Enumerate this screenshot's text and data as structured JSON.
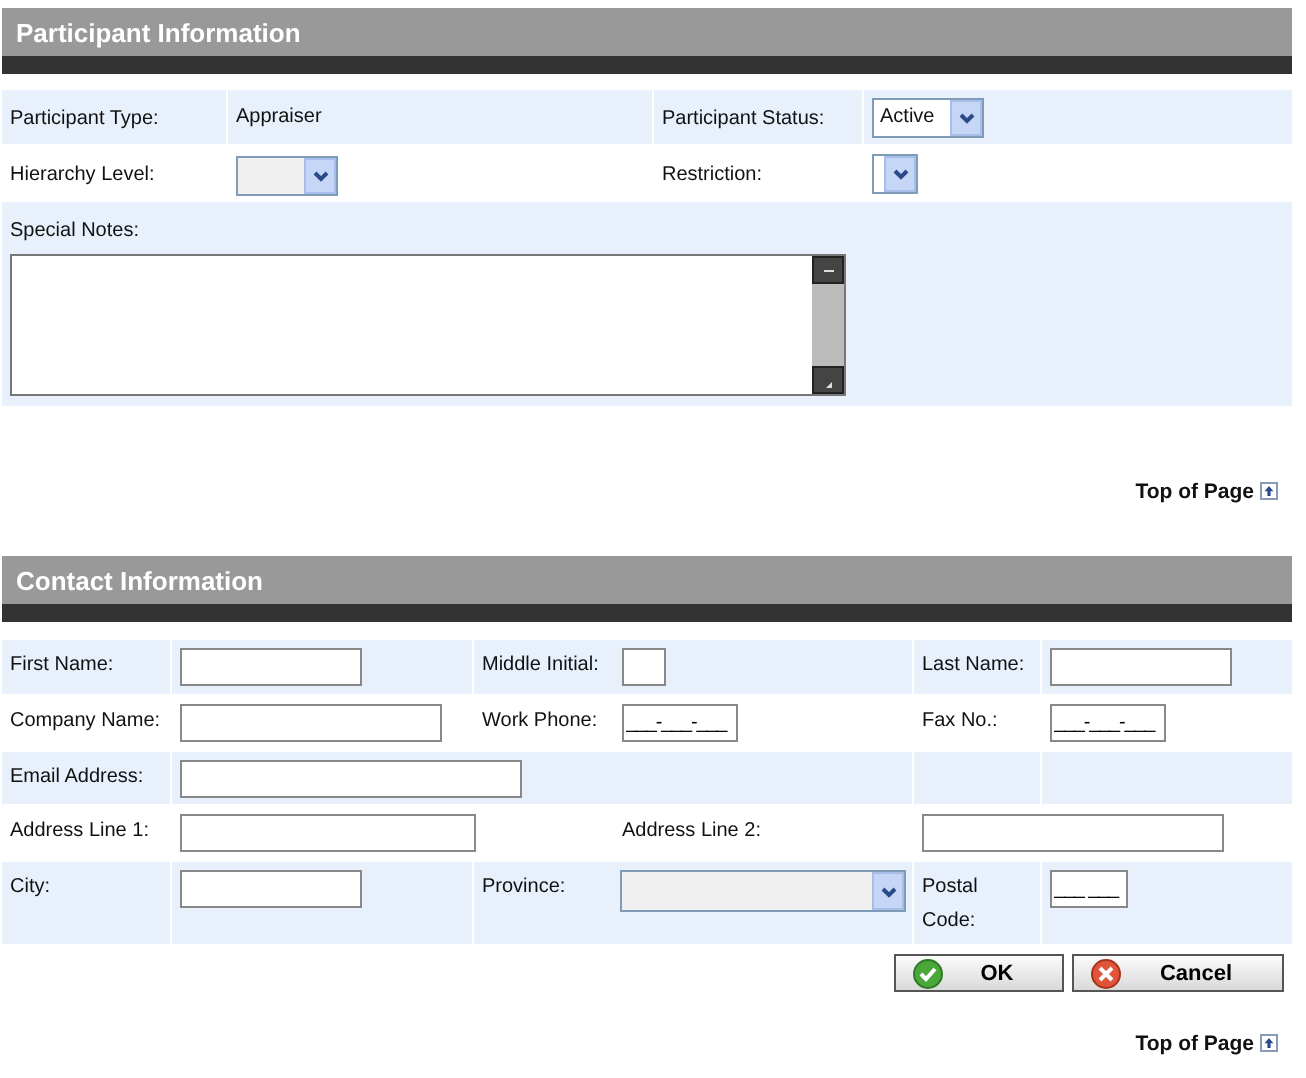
{
  "participant_section": {
    "title": "Participant Information",
    "rows": [
      {
        "kind": "double",
        "cells": [
          {
            "kind": "label",
            "text": "Participant Type:"
          },
          {
            "kind": "text",
            "text": "Appraiser"
          },
          {
            "kind": "label",
            "text": "Participant Status:"
          },
          {
            "kind": "select",
            "value": "Active",
            "disabled": false
          }
        ]
      },
      {
        "kind": "double",
        "cells": [
          {
            "kind": "label",
            "text": "Hierarchy Level:"
          },
          {
            "kind": "select",
            "disabled": true
          },
          {
            "kind": "label",
            "text": "Restriction:"
          },
          {
            "kind": "select",
            "disabled": false
          }
        ]
      },
      {
        "kind": "notes",
        "cells": [
          {
            "kind": "label",
            "text": "Special Notes:"
          },
          {
            "kind": "textarea"
          }
        ]
      }
    ],
    "top_link": "Top of Page"
  },
  "contact_section": {
    "title": "Contact Information",
    "rows": [
      {
        "kind": "triple",
        "cells": [
          {
            "kind": "label",
            "text": "First Name:"
          },
          {
            "kind": "input"
          },
          {
            "kind": "label",
            "text": "Middle Initial:"
          },
          {
            "kind": "input"
          },
          {
            "kind": "label",
            "text": "Last Name:"
          },
          {
            "kind": "input"
          }
        ]
      },
      {
        "kind": "triple",
        "cells": [
          {
            "kind": "label",
            "text": "Company Name:"
          },
          {
            "kind": "input"
          },
          {
            "kind": "label",
            "text": "Work Phone:"
          },
          {
            "kind": "input",
            "value": "___-___-___"
          },
          {
            "kind": "label",
            "text": "Fax No.:"
          },
          {
            "kind": "input",
            "value": "___-___-___"
          }
        ]
      },
      {
        "kind": "single",
        "cells": [
          {
            "kind": "label",
            "text": "Email Address:"
          },
          {
            "kind": "input"
          }
        ]
      },
      {
        "kind": "address",
        "cells": [
          {
            "kind": "label",
            "text": "Address Line 1:"
          },
          {
            "kind": "input"
          },
          "",
          {
            "kind": "label",
            "text": "Address Line 2:"
          },
          {
            "kind": "input"
          }
        ]
      },
      {
        "kind": "triple",
        "cells": [
          {
            "kind": "label",
            "text": "City:"
          },
          {
            "kind": "input"
          },
          {
            "kind": "label",
            "text": "Province:"
          },
          {
            "kind": "select",
            "disabled": true
          },
          {
            "kind": "label",
            "text": "Postal Code:"
          },
          {
            "kind": "input",
            "value": "___ ___"
          }
        ]
      }
    ],
    "buttons": [
      {
        "kind": "ok",
        "label": "OK"
      },
      {
        "kind": "cancel",
        "label": "Cancel"
      }
    ],
    "top_link": "Top of Page"
  }
}
